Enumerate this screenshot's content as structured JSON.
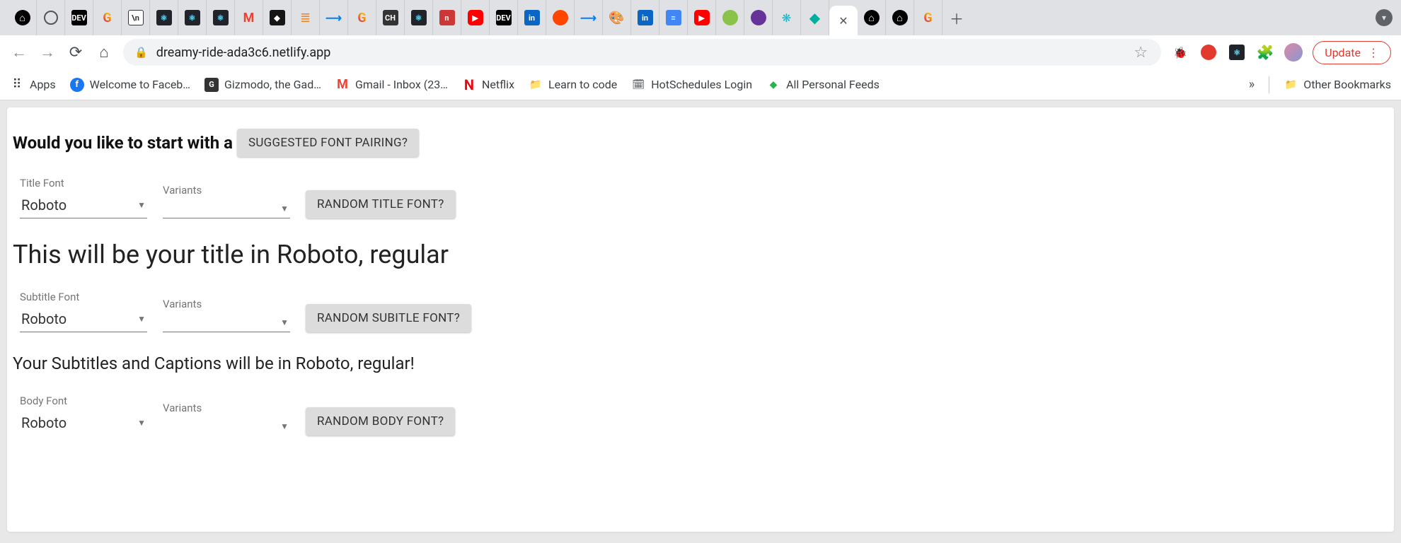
{
  "browser": {
    "url": "dreamy-ride-ada3c6.netlify.app",
    "update_label": "Update"
  },
  "bookmarks": {
    "apps": "Apps",
    "facebook": "Welcome to Faceb…",
    "gizmodo": "Gizmodo, the Gad…",
    "gmail": "Gmail - Inbox (23…",
    "netflix": "Netflix",
    "learn": "Learn to code",
    "hotschedules": "HotSchedules Login",
    "feeds": "All Personal Feeds",
    "other": "Other Bookmarks"
  },
  "page": {
    "question_prefix": "Would you like to start with a",
    "suggested_btn": "SUGGESTED FONT PAIRING?",
    "sections": {
      "title": {
        "font_label": "Title Font",
        "variants_label": "Variants",
        "font_value": "Roboto",
        "variants_value": "",
        "random_btn": "RANDOM TITLE FONT?",
        "preview": "This will be your title in Roboto, regular"
      },
      "subtitle": {
        "font_label": "Subtitle Font",
        "variants_label": "Variants",
        "font_value": "Roboto",
        "variants_value": "",
        "random_btn": "RANDOM SUBITLE FONT?",
        "preview": "Your Subtitles and Captions will be in Roboto, regular!"
      },
      "body": {
        "font_label": "Body Font",
        "variants_label": "Variants",
        "font_value": "Roboto",
        "variants_value": "",
        "random_btn": "RANDOM BODY FONT?"
      }
    }
  }
}
